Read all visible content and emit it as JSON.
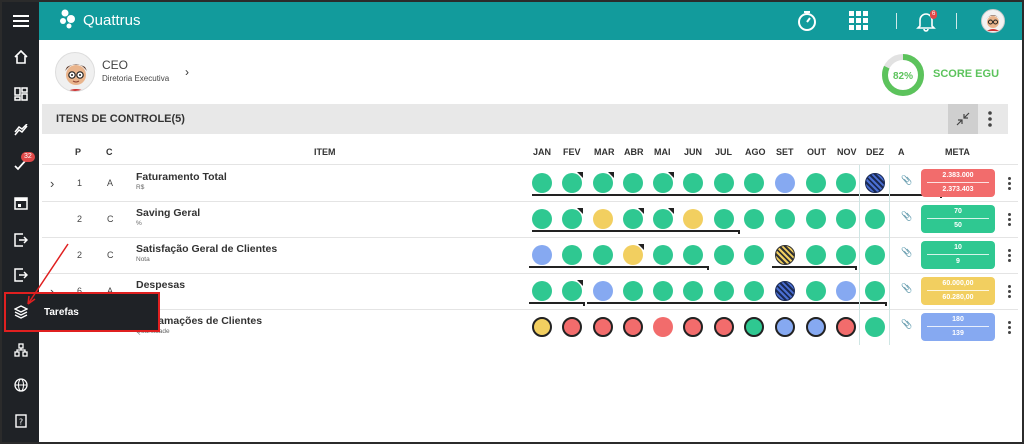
{
  "app": {
    "brand": "Quattrus",
    "notifications_count": "6",
    "colors": {
      "header": "#129b9c",
      "sidebar": "#1f2226",
      "accent_green": "#5cc35c"
    }
  },
  "sidebar": {
    "badge": "32",
    "items": [
      {
        "icon": "menu-icon"
      },
      {
        "icon": "home-icon"
      },
      {
        "icon": "dashboard-icon"
      },
      {
        "icon": "chart-line-icon"
      },
      {
        "icon": "check-tasks-icon"
      },
      {
        "icon": "calendar-icon"
      },
      {
        "icon": "exit-icon"
      },
      {
        "icon": "exit-icon"
      },
      {
        "icon": "layers-icon"
      },
      {
        "icon": "org-chart-icon"
      },
      {
        "icon": "globe-icon"
      },
      {
        "icon": "help-icon"
      }
    ],
    "tooltip": "Tarefas"
  },
  "profile": {
    "title": "CEO",
    "subtitle": "Diretoria Executiva"
  },
  "score": {
    "value_text": "82%",
    "value": 82,
    "label": "SCORE EGU"
  },
  "section": {
    "title": "ITENS DE CONTROLE(5)"
  },
  "table": {
    "headers": {
      "p": "P",
      "c": "C",
      "item": "ITEM",
      "months": [
        "JAN",
        "FEV",
        "MAR",
        "ABR",
        "MAI",
        "JUN",
        "JUL",
        "AGO",
        "SET",
        "OUT",
        "NOV",
        "DEZ"
      ],
      "a": "A",
      "meta": "META"
    },
    "rows": [
      {
        "p": "1",
        "c": "A",
        "name": "Faturamento Total",
        "unit": "R$",
        "expandable": true,
        "attachment": false,
        "statuses": [
          "green",
          "green",
          "green",
          "green",
          "green",
          "green",
          "green",
          "green",
          "blue",
          "green",
          "green",
          "striped-blue"
        ],
        "flags": [
          0,
          1,
          1,
          0,
          1,
          0,
          0,
          0,
          0,
          0,
          0,
          0
        ],
        "meta_color": "#f26c6c",
        "meta_target": "2.383.000",
        "meta_actual": "2.373.403"
      },
      {
        "p": "2",
        "c": "C",
        "name": "Saving Geral",
        "unit": "%",
        "expandable": false,
        "attachment": false,
        "statuses": [
          "green",
          "green",
          "yellow",
          "green",
          "green",
          "yellow",
          "green",
          "green",
          "green",
          "green",
          "green",
          "green"
        ],
        "flags": [
          0,
          1,
          0,
          1,
          1,
          0,
          0,
          0,
          0,
          0,
          0,
          0
        ],
        "meta_color": "#2fc891",
        "meta_target": "70",
        "meta_actual": "50"
      },
      {
        "p": "2",
        "c": "C",
        "name": "Satisfação Geral de Clientes",
        "unit": "Nota",
        "expandable": false,
        "attachment": true,
        "statuses": [
          "blue",
          "green",
          "green",
          "yellow",
          "green",
          "green",
          "green",
          "green",
          "striped-yellow",
          "green",
          "green",
          "green"
        ],
        "flags": [
          0,
          0,
          0,
          1,
          0,
          0,
          0,
          0,
          0,
          0,
          0,
          0
        ],
        "meta_color": "#2fc891",
        "meta_target": "10",
        "meta_actual": "9"
      },
      {
        "p": "6",
        "c": "A",
        "name": "Despesas",
        "unit": "",
        "expandable": true,
        "attachment": false,
        "statuses": [
          "green",
          "green",
          "blue",
          "green",
          "green",
          "green",
          "green",
          "green",
          "striped-blue",
          "green",
          "blue",
          "green"
        ],
        "flags": [
          0,
          1,
          0,
          0,
          0,
          0,
          0,
          0,
          0,
          0,
          0,
          0
        ],
        "meta_color": "#f2cf60",
        "meta_target": "60.000,00",
        "meta_actual": "60.280,00"
      },
      {
        "p": "",
        "c": "",
        "name": "Reclamações de Clientes",
        "unit": "Quantidade",
        "expandable": false,
        "attachment": false,
        "statuses": [
          "yellow-ring",
          "red-ring",
          "red-ring",
          "red-ring",
          "red",
          "red-ring",
          "red-ring",
          "green-ring",
          "blue-ring",
          "blue-ring",
          "red-ring",
          "green"
        ],
        "flags": [
          0,
          0,
          0,
          0,
          0,
          0,
          0,
          0,
          0,
          0,
          0,
          0
        ],
        "meta_color": "#86a9f1",
        "meta_target": "180",
        "meta_actual": "139"
      }
    ]
  }
}
